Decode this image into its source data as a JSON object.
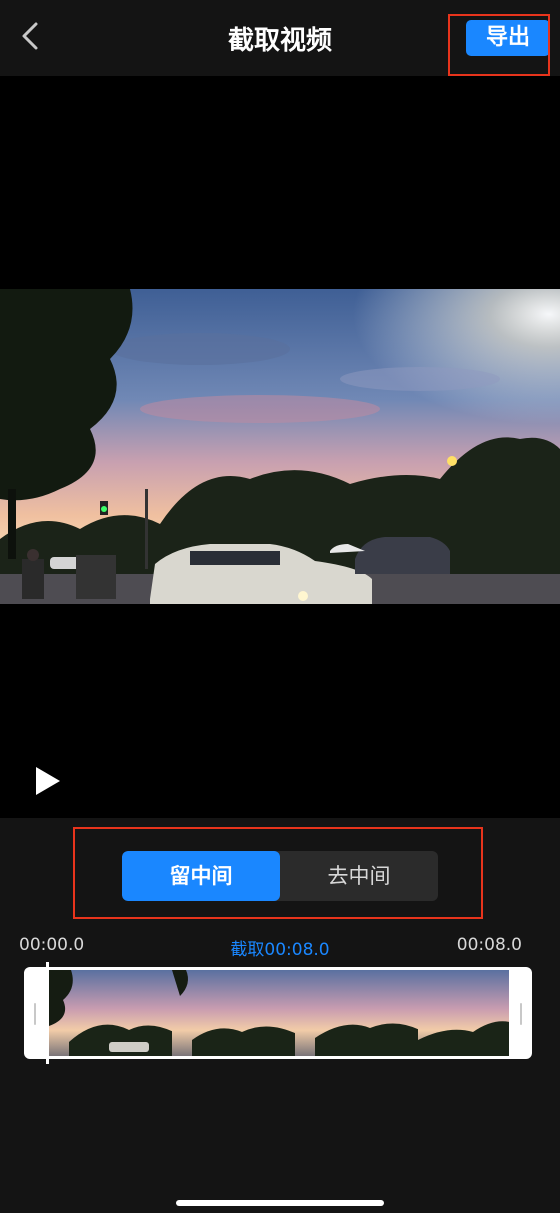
{
  "header": {
    "title": "截取视频",
    "export_label": "导出"
  },
  "segment": {
    "options": [
      "留中间",
      "去中间"
    ],
    "selected": "留中间"
  },
  "timeline": {
    "start_time": "00:00.0",
    "clip_label": "截取00:08.0",
    "end_time": "00:08.0"
  },
  "colors": {
    "accent": "#1a87ff",
    "highlight_box": "#e8341c",
    "panel_bg": "#141414"
  }
}
